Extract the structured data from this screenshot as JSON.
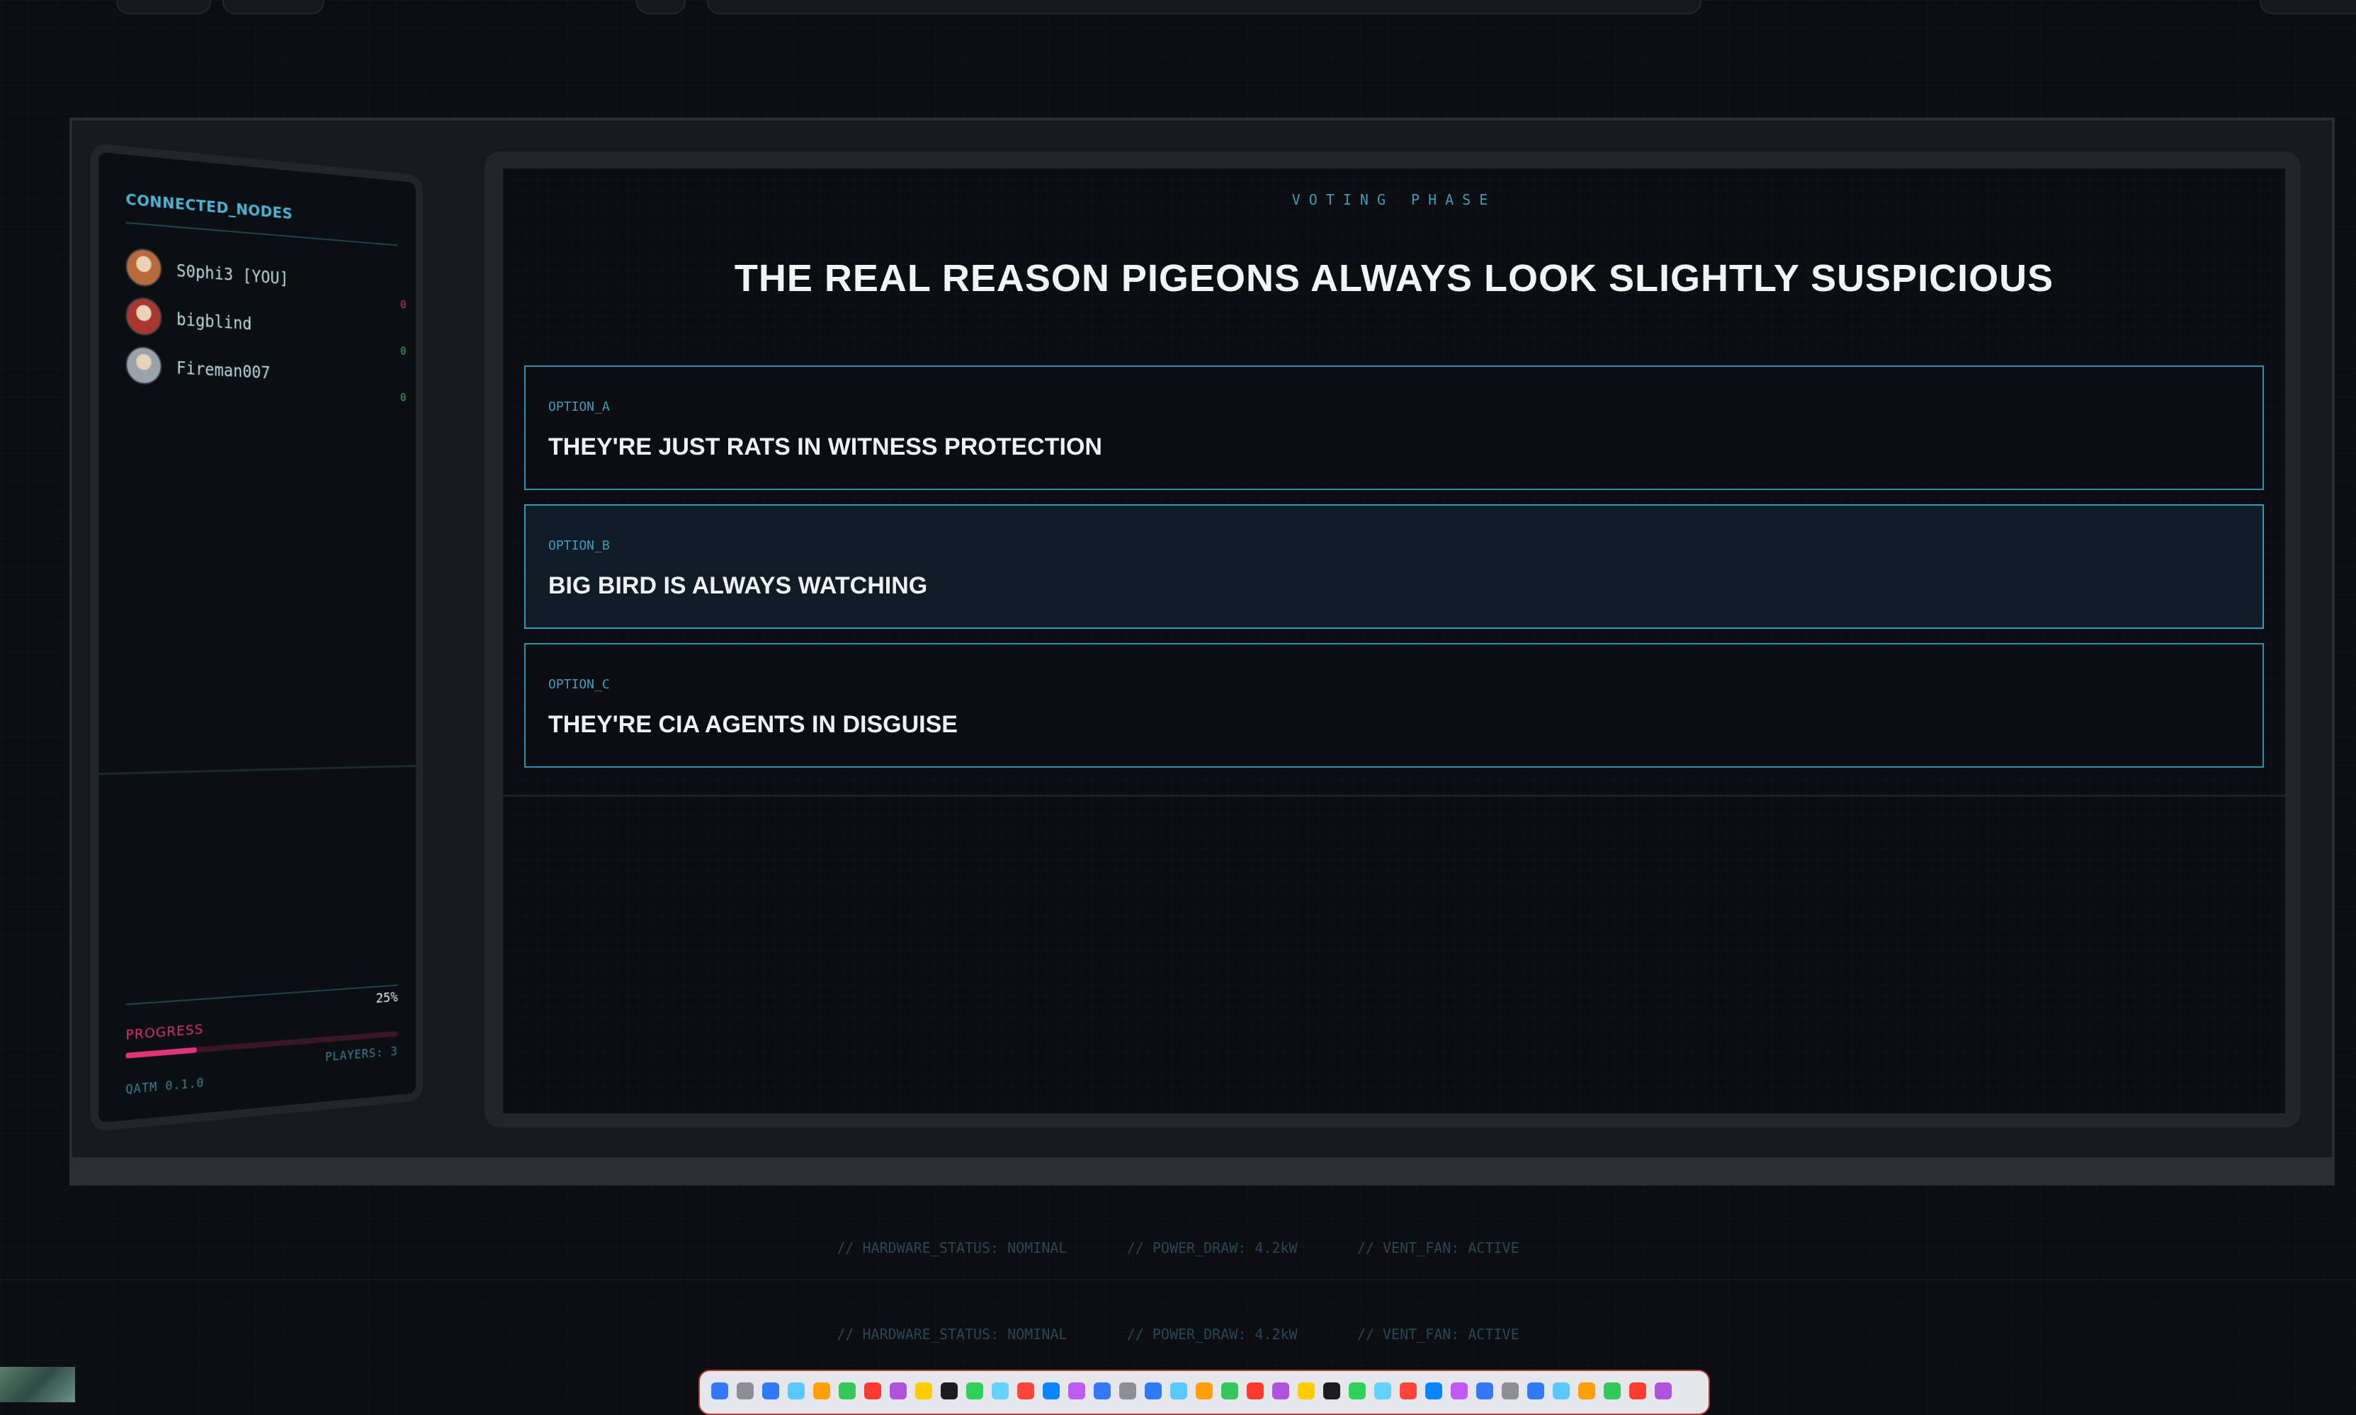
{
  "sidebar": {
    "title": "CONNECTED_NODES",
    "players": [
      {
        "name": "S0phi3 [YOU]",
        "score": "0",
        "score_color": "#d6336c",
        "avatar_color": "#b86a3c"
      },
      {
        "name": "bigblind",
        "score": "0",
        "score_color": "#3fb36b",
        "avatar_color": "#a8382f"
      },
      {
        "name": "Fireman007",
        "score": "0",
        "score_color": "#3fb36b",
        "avatar_color": "#9aa3ab"
      }
    ],
    "progress_label": "PROGRESS",
    "progress_value": "25%",
    "progress_fraction": 0.25,
    "version": "QATM 0.1.0",
    "players_count": "PLAYERS: 3"
  },
  "main": {
    "phase": "VOTING PHASE",
    "question": "THE REAL REASON PIGEONS ALWAYS LOOK SLIGHTLY SUSPICIOUS",
    "options": [
      {
        "id": "OPTION_A",
        "text": "THEY'RE JUST RATS IN WITNESS PROTECTION",
        "selected": false
      },
      {
        "id": "OPTION_B",
        "text": "BIG BIRD IS ALWAYS WATCHING",
        "selected": true
      },
      {
        "id": "OPTION_C",
        "text": "THEY'RE CIA AGENTS IN DISGUISE",
        "selected": false
      }
    ]
  },
  "status": {
    "line1": "// HARDWARE_STATUS: NOMINAL       // POWER_DRAW: 4.2kW       // VENT_FAN: ACTIVE",
    "line2": "// HARDWARE_STATUS: NOMINAL       // POWER_DRAW: 4.2kW       // VENT_FAN: ACTIVE"
  },
  "colors": {
    "accent": "#4fb3d6",
    "progress": "#e0347a",
    "background": "#0c0e11"
  }
}
